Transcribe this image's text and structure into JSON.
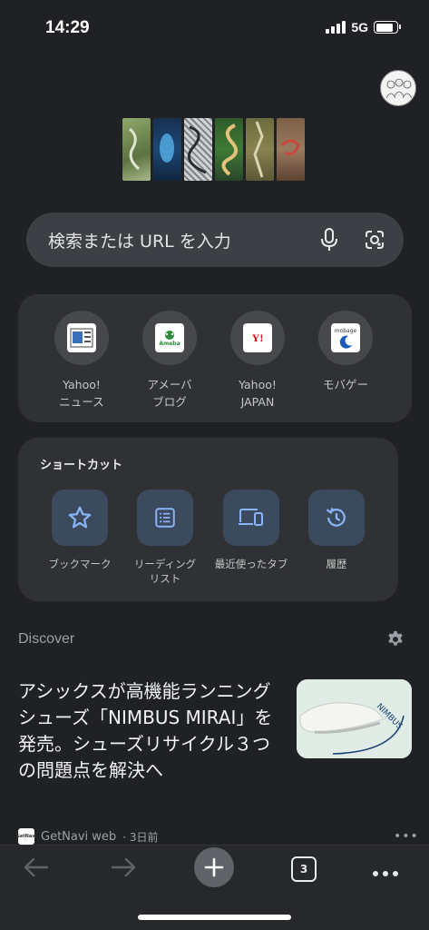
{
  "status": {
    "time": "14:29",
    "network": "5G"
  },
  "search": {
    "placeholder": "検索または URL を入力"
  },
  "most_visited": [
    {
      "label": "Yahoo!\nニュース",
      "icon": "yahoo-news-icon"
    },
    {
      "label": "アメーバ\nブログ",
      "icon": "ameba-icon",
      "favicon_text": "Ameba"
    },
    {
      "label": "Yahoo!\nJAPAN",
      "icon": "yahoo-japan-icon",
      "favicon_text": "Y!"
    },
    {
      "label": "モバゲー",
      "icon": "mobage-icon",
      "favicon_text": "mobage"
    }
  ],
  "shortcuts": {
    "title": "ショートカット",
    "items": [
      {
        "label": "ブックマーク",
        "icon": "star-icon"
      },
      {
        "label": "リーディング\nリスト",
        "icon": "reading-list-icon"
      },
      {
        "label": "最近使ったタブ",
        "icon": "recent-tabs-icon"
      },
      {
        "label": "履歴",
        "icon": "history-icon"
      }
    ]
  },
  "discover": {
    "label": "Discover",
    "article": {
      "title": "アシックスが高機能ランニングシューズ「NIMBUS MIRAI」を発売。シューズリサイクル３つの問題点を解決へ",
      "source": "GetNavi web",
      "time": "· 3日前",
      "thumb_text": "NIMBUS",
      "source_logo_text": "GetNavi"
    }
  },
  "toolbar": {
    "tab_count": "3"
  },
  "colors": {
    "background": "#202124",
    "card": "#303134",
    "accent": "#8ab4f8",
    "shortcut_tile": "#3c4a5e"
  }
}
